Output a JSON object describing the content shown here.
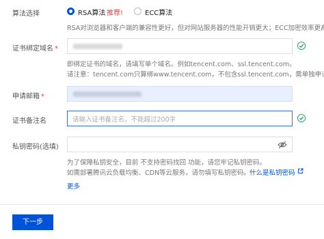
{
  "algorithm": {
    "label": "算法选择",
    "options": [
      {
        "label": "RSA算法",
        "selected": true
      },
      {
        "label": "ECC算法",
        "selected": false
      }
    ],
    "recommend": "推荐!",
    "hint": "RSA对浏览器和客户端的兼容性更好，但对网站服务器的性能开销更大；ECC加密效率更高"
  },
  "domain": {
    "label": "证书绑定域名",
    "hint_line1": "即绑定证书的域名，请填写单个域名。例如tencent.com、ssl.tencent.com。",
    "hint_line2": "请注意：tencent.com只算绑www.tencent.com，不包含ssl.tencent.com，需单独申请。"
  },
  "email": {
    "label": "申请邮箱"
  },
  "remark": {
    "label": "证书备注名",
    "placeholder": "请输入证书备注名，不能超过200字"
  },
  "password": {
    "label": "私钥密码(选填)",
    "hint_line1": "为了保障私钥安全，目前 不支持密码找回 功能，请您牢记私钥密码。",
    "hint_line2": "如需部署腾讯云负载均衡、CDN等云服务，请勿填写私钥密码。",
    "link": "什么是私钥密码",
    "more": "更多"
  },
  "next_button": "下一步",
  "colors": {
    "primary": "#0052d9",
    "success": "#2ba471",
    "required": "#e54545",
    "disabled_bg": "#e8effd"
  }
}
